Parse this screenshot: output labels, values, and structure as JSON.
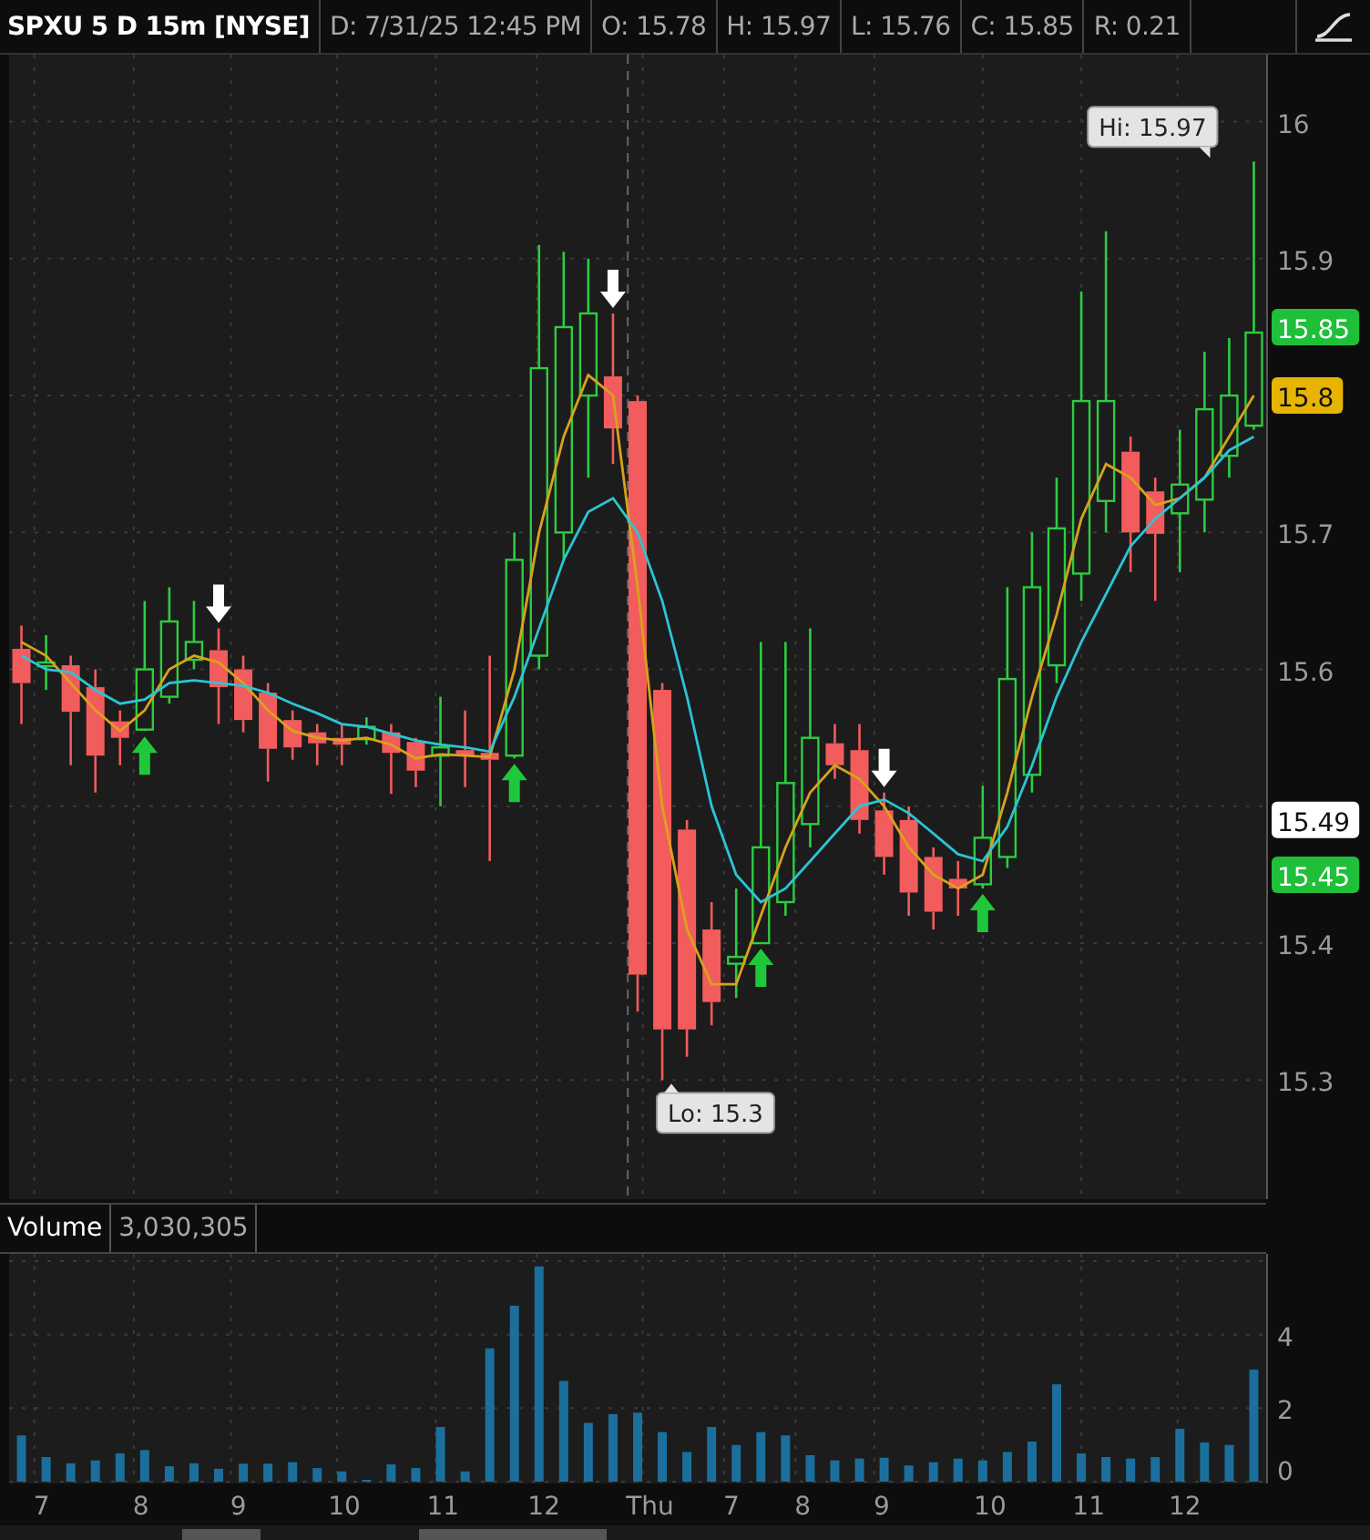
{
  "header": {
    "cells": [
      {
        "text": "SPXU 5 D 15m [NYSE]",
        "kind": "symbol"
      },
      {
        "text": "D: 7/31/25 12:45 PM",
        "kind": "field"
      },
      {
        "text": "O: 15.78",
        "kind": "field"
      },
      {
        "text": "H: 15.97",
        "kind": "field"
      },
      {
        "text": "L: 15.76",
        "kind": "field"
      },
      {
        "text": "C: 15.85",
        "kind": "field"
      },
      {
        "text": "R: 0.21",
        "kind": "field"
      }
    ]
  },
  "price_pane": {
    "chart_data": {
      "type": "candlestick",
      "grid": true,
      "ylim": [
        15.213,
        16.049
      ],
      "yticks": [
        {
          "value": 15.3,
          "label": "15.3"
        },
        {
          "value": 15.4,
          "label": "15.4"
        },
        {
          "value": 15.6,
          "label": "15.6"
        },
        {
          "value": 15.7,
          "label": "15.7"
        },
        {
          "value": 15.9,
          "label": "15.9"
        },
        {
          "value": 16,
          "label": "16"
        }
      ],
      "ohlc": [
        [
          15.615,
          15.632,
          15.56,
          15.59
        ],
        [
          15.603,
          15.625,
          15.585,
          15.605
        ],
        [
          15.603,
          15.61,
          15.53,
          15.569
        ],
        [
          15.587,
          15.6,
          15.51,
          15.537
        ],
        [
          15.562,
          15.57,
          15.53,
          15.55
        ],
        [
          15.556,
          15.65,
          15.555,
          15.6
        ],
        [
          15.58,
          15.66,
          15.575,
          15.635
        ],
        [
          15.607,
          15.65,
          15.6,
          15.62
        ],
        [
          15.614,
          15.63,
          15.56,
          15.587
        ],
        [
          15.6,
          15.61,
          15.554,
          15.563
        ],
        [
          15.583,
          15.59,
          15.518,
          15.542
        ],
        [
          15.563,
          15.57,
          15.534,
          15.543
        ],
        [
          15.554,
          15.56,
          15.53,
          15.546
        ],
        [
          15.55,
          15.56,
          15.53,
          15.545
        ],
        [
          15.549,
          15.565,
          15.545,
          15.558
        ],
        [
          15.554,
          15.56,
          15.509,
          15.539
        ],
        [
          15.547,
          15.55,
          15.514,
          15.526
        ],
        [
          15.537,
          15.58,
          15.5,
          15.543
        ],
        [
          15.541,
          15.57,
          15.514,
          15.537
        ],
        [
          15.539,
          15.61,
          15.46,
          15.534
        ],
        [
          15.537,
          15.7,
          15.535,
          15.68
        ],
        [
          15.61,
          15.91,
          15.6,
          15.82
        ],
        [
          15.7,
          15.905,
          15.68,
          15.85
        ],
        [
          15.8,
          15.9,
          15.74,
          15.86
        ],
        [
          15.814,
          15.86,
          15.75,
          15.776
        ],
        [
          15.796,
          15.8,
          15.35,
          15.377
        ],
        [
          15.585,
          15.59,
          15.3,
          15.337
        ],
        [
          15.483,
          15.49,
          15.317,
          15.337
        ],
        [
          15.41,
          15.43,
          15.34,
          15.357
        ],
        [
          15.385,
          15.44,
          15.36,
          15.39
        ],
        [
          15.4,
          15.62,
          15.4,
          15.47
        ],
        [
          15.43,
          15.62,
          15.42,
          15.517
        ],
        [
          15.487,
          15.63,
          15.47,
          15.55
        ],
        [
          15.546,
          15.56,
          15.52,
          15.53
        ],
        [
          15.541,
          15.56,
          15.48,
          15.49
        ],
        [
          15.497,
          15.51,
          15.45,
          15.463
        ],
        [
          15.49,
          15.5,
          15.42,
          15.437
        ],
        [
          15.463,
          15.47,
          15.41,
          15.423
        ],
        [
          15.447,
          15.46,
          15.42,
          15.44
        ],
        [
          15.443,
          15.515,
          15.44,
          15.477
        ],
        [
          15.463,
          15.66,
          15.455,
          15.593
        ],
        [
          15.523,
          15.7,
          15.51,
          15.66
        ],
        [
          15.603,
          15.74,
          15.59,
          15.703
        ],
        [
          15.67,
          15.876,
          15.65,
          15.796
        ],
        [
          15.723,
          15.92,
          15.7,
          15.796
        ],
        [
          15.759,
          15.77,
          15.671,
          15.7
        ],
        [
          15.73,
          15.74,
          15.65,
          15.699
        ],
        [
          15.714,
          15.775,
          15.671,
          15.735
        ],
        [
          15.724,
          15.832,
          15.7,
          15.79
        ],
        [
          15.756,
          15.842,
          15.74,
          15.8
        ],
        [
          15.778,
          15.971,
          15.775,
          15.846
        ]
      ],
      "series": [
        {
          "type": "line",
          "color": "#d9a21c",
          "values": [
            15.62,
            15.61,
            15.59,
            15.57,
            15.555,
            15.57,
            15.6,
            15.61,
            15.605,
            15.59,
            15.57,
            15.555,
            15.55,
            15.548,
            15.55,
            15.545,
            15.535,
            15.538,
            15.537,
            15.536,
            15.6,
            15.7,
            15.77,
            15.815,
            15.8,
            15.66,
            15.5,
            15.41,
            15.37,
            15.37,
            15.42,
            15.47,
            15.51,
            15.53,
            15.52,
            15.5,
            15.47,
            15.45,
            15.44,
            15.45,
            15.51,
            15.58,
            15.64,
            15.71,
            15.75,
            15.74,
            15.72,
            15.725,
            15.74,
            15.77,
            15.8
          ]
        },
        {
          "type": "line",
          "color": "#2cc4d4",
          "values": [
            15.61,
            15.6,
            15.598,
            15.585,
            15.575,
            15.578,
            15.59,
            15.592,
            15.59,
            15.588,
            15.583,
            15.575,
            15.568,
            15.56,
            15.558,
            15.553,
            15.548,
            15.545,
            15.543,
            15.54,
            15.58,
            15.63,
            15.68,
            15.715,
            15.725,
            15.7,
            15.65,
            15.58,
            15.5,
            15.45,
            15.43,
            15.44,
            15.46,
            15.48,
            15.5,
            15.505,
            15.495,
            15.48,
            15.465,
            15.46,
            15.485,
            15.53,
            15.58,
            15.62,
            15.655,
            15.69,
            15.71,
            15.725,
            15.74,
            15.76,
            15.77
          ]
        },
        {
          "type": "scatter",
          "color": "#1fc83a",
          "values": [
            null,
            null,
            null,
            null,
            null,
            15.537,
            null,
            null,
            null,
            null,
            null,
            null,
            null,
            null,
            null,
            null,
            null,
            null,
            null,
            null,
            15.517,
            null,
            null,
            null,
            null,
            null,
            null,
            null,
            null,
            null,
            15.382,
            null,
            null,
            null,
            null,
            null,
            null,
            null,
            null,
            15.422,
            null,
            null,
            null,
            null,
            null,
            null,
            null,
            null,
            null,
            null,
            null
          ]
        },
        {
          "type": "scatter",
          "color": "#ffffff",
          "values": [
            null,
            null,
            null,
            null,
            null,
            null,
            null,
            null,
            15.648,
            null,
            null,
            null,
            null,
            null,
            null,
            null,
            null,
            null,
            null,
            null,
            null,
            null,
            null,
            null,
            15.878,
            null,
            null,
            null,
            null,
            null,
            null,
            null,
            null,
            null,
            null,
            15.528,
            null,
            null,
            null,
            null,
            null,
            null,
            null,
            null,
            null,
            null,
            null,
            null,
            null,
            null,
            null
          ]
        }
      ],
      "annotations": [
        "Hi: 15.97",
        "Lo: 15.3"
      ]
    },
    "price_markers": [
      {
        "text": "15.85",
        "color": "#1fbf3a"
      },
      {
        "text": "15.8",
        "color": "#e7b400"
      },
      {
        "text": "15.49",
        "color": "#ffffff"
      },
      {
        "text": "15.45",
        "color": "#1fbf3a"
      }
    ]
  },
  "volume_pane": {
    "reading": "3,030,305",
    "time_axis": [
      {
        "text": "7"
      },
      {
        "text": "8"
      },
      {
        "text": "9"
      },
      {
        "text": "10"
      },
      {
        "text": "11"
      },
      {
        "text": "12"
      },
      {
        "text": "Thu"
      },
      {
        "text": "7"
      },
      {
        "text": "8"
      },
      {
        "text": "9"
      },
      {
        "text": "10"
      },
      {
        "text": "11"
      },
      {
        "text": "12"
      }
    ],
    "chart_data": {
      "type": "bar",
      "grid": true,
      "ylim": [
        0,
        6.2
      ],
      "yticks": [
        {
          "value": 0,
          "label": "0"
        },
        {
          "value": 2,
          "label": "2"
        },
        {
          "value": 4,
          "label": "4"
        }
      ],
      "series": [
        {
          "name": "Volume",
          "color": "#1b6f9c",
          "values": [
            1.26,
            0.67,
            0.5,
            0.58,
            0.77,
            0.86,
            0.42,
            0.5,
            0.35,
            0.49,
            0.49,
            0.53,
            0.37,
            0.28,
            0.05,
            0.47,
            0.37,
            1.49,
            0.28,
            3.63,
            4.79,
            5.86,
            2.74,
            1.6,
            1.84,
            1.88,
            1.35,
            0.81,
            1.49,
            1.0,
            1.35,
            1.26,
            0.72,
            0.58,
            0.63,
            0.65,
            0.44,
            0.53,
            0.63,
            0.58,
            0.81,
            1.09,
            2.65,
            0.77,
            0.67,
            0.63,
            0.67,
            1.44,
            1.07,
            1.0,
            3.05
          ]
        }
      ]
    }
  }
}
